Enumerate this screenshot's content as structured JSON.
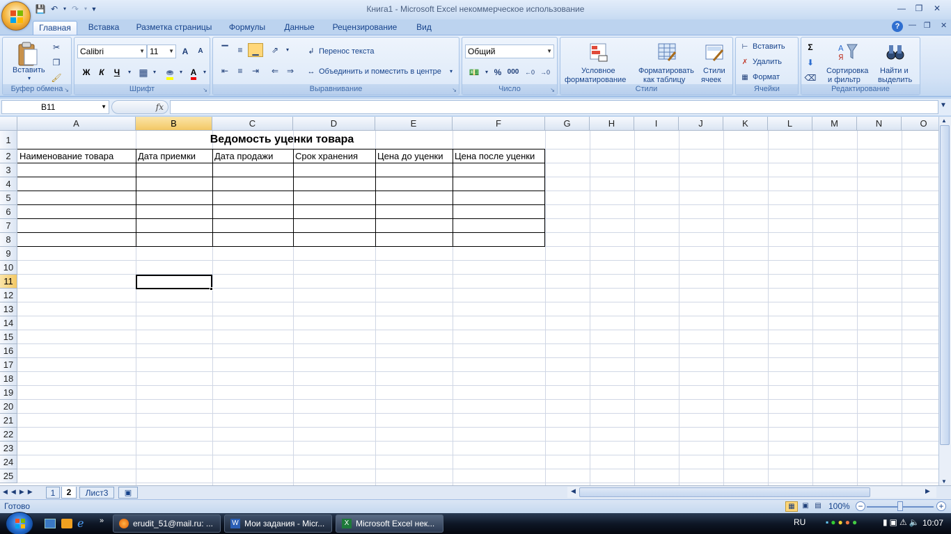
{
  "window": {
    "title": "Книга1  -  Microsoft Excel некоммерческое использование",
    "quick_access": [
      "save-icon",
      "undo-icon",
      "redo-icon",
      "customize-icon"
    ]
  },
  "tabs": [
    "Главная",
    "Вставка",
    "Разметка страницы",
    "Формулы",
    "Данные",
    "Рецензирование",
    "Вид"
  ],
  "active_tab": "Главная",
  "ribbon": {
    "clipboard": {
      "paste": "Вставить",
      "label": "Буфер обмена"
    },
    "font": {
      "name": "Calibri",
      "size": "11",
      "bold": "Ж",
      "italic": "К",
      "underline": "Ч",
      "grow": "A",
      "shrink": "A",
      "label": "Шрифт"
    },
    "alignment": {
      "wrap": "Перенос текста",
      "merge": "Объединить и поместить в центре",
      "label": "Выравнивание"
    },
    "number": {
      "format": "Общий",
      "percent": "%",
      "thousands": "000",
      "label": "Число"
    },
    "styles": {
      "conditional": "Условное",
      "conditional2": "форматирование",
      "table": "Форматировать",
      "table2": "как таблицу",
      "cell": "Стили",
      "cell2": "ячеек",
      "label": "Стили"
    },
    "cells": {
      "insert": "Вставить",
      "delete": "Удалить",
      "format": "Формат",
      "label": "Ячейки"
    },
    "editing": {
      "sort": "Сортировка",
      "sort2": "и фильтр",
      "find": "Найти и",
      "find2": "выделить",
      "label": "Редактирование",
      "sum": "Σ"
    }
  },
  "formula_bar": {
    "name_box": "B11",
    "fx": "fx",
    "content": ""
  },
  "columns": [
    "A",
    "B",
    "C",
    "D",
    "E",
    "F",
    "G",
    "H",
    "I",
    "J",
    "K",
    "L",
    "M",
    "N",
    "O"
  ],
  "rows": [
    "1",
    "2",
    "3",
    "4",
    "5",
    "6",
    "7",
    "8",
    "9",
    "10",
    "11",
    "12",
    "13",
    "14",
    "15",
    "16",
    "17",
    "18",
    "19",
    "20",
    "21",
    "22",
    "23",
    "24",
    "25"
  ],
  "selected_cell": "B11",
  "sheet": {
    "title": "Ведомость уценки товара",
    "headers": [
      "Наименование товара",
      "Дата приемки",
      "Дата продажи",
      "Срок хранения",
      "Цена до уценки",
      "Цена после уценки"
    ]
  },
  "sheet_tabs": [
    "1",
    "2",
    "Лист3"
  ],
  "active_sheet": "2",
  "status": {
    "ready": "Готово",
    "zoom": "100%"
  },
  "taskbar": {
    "tasks": [
      "erudit_51@mail.ru: ...",
      "Мои задания - Micr...",
      "Microsoft Excel нек..."
    ],
    "active_task": "Microsoft Excel нек...",
    "lang": "RU",
    "clock": "10:07"
  }
}
